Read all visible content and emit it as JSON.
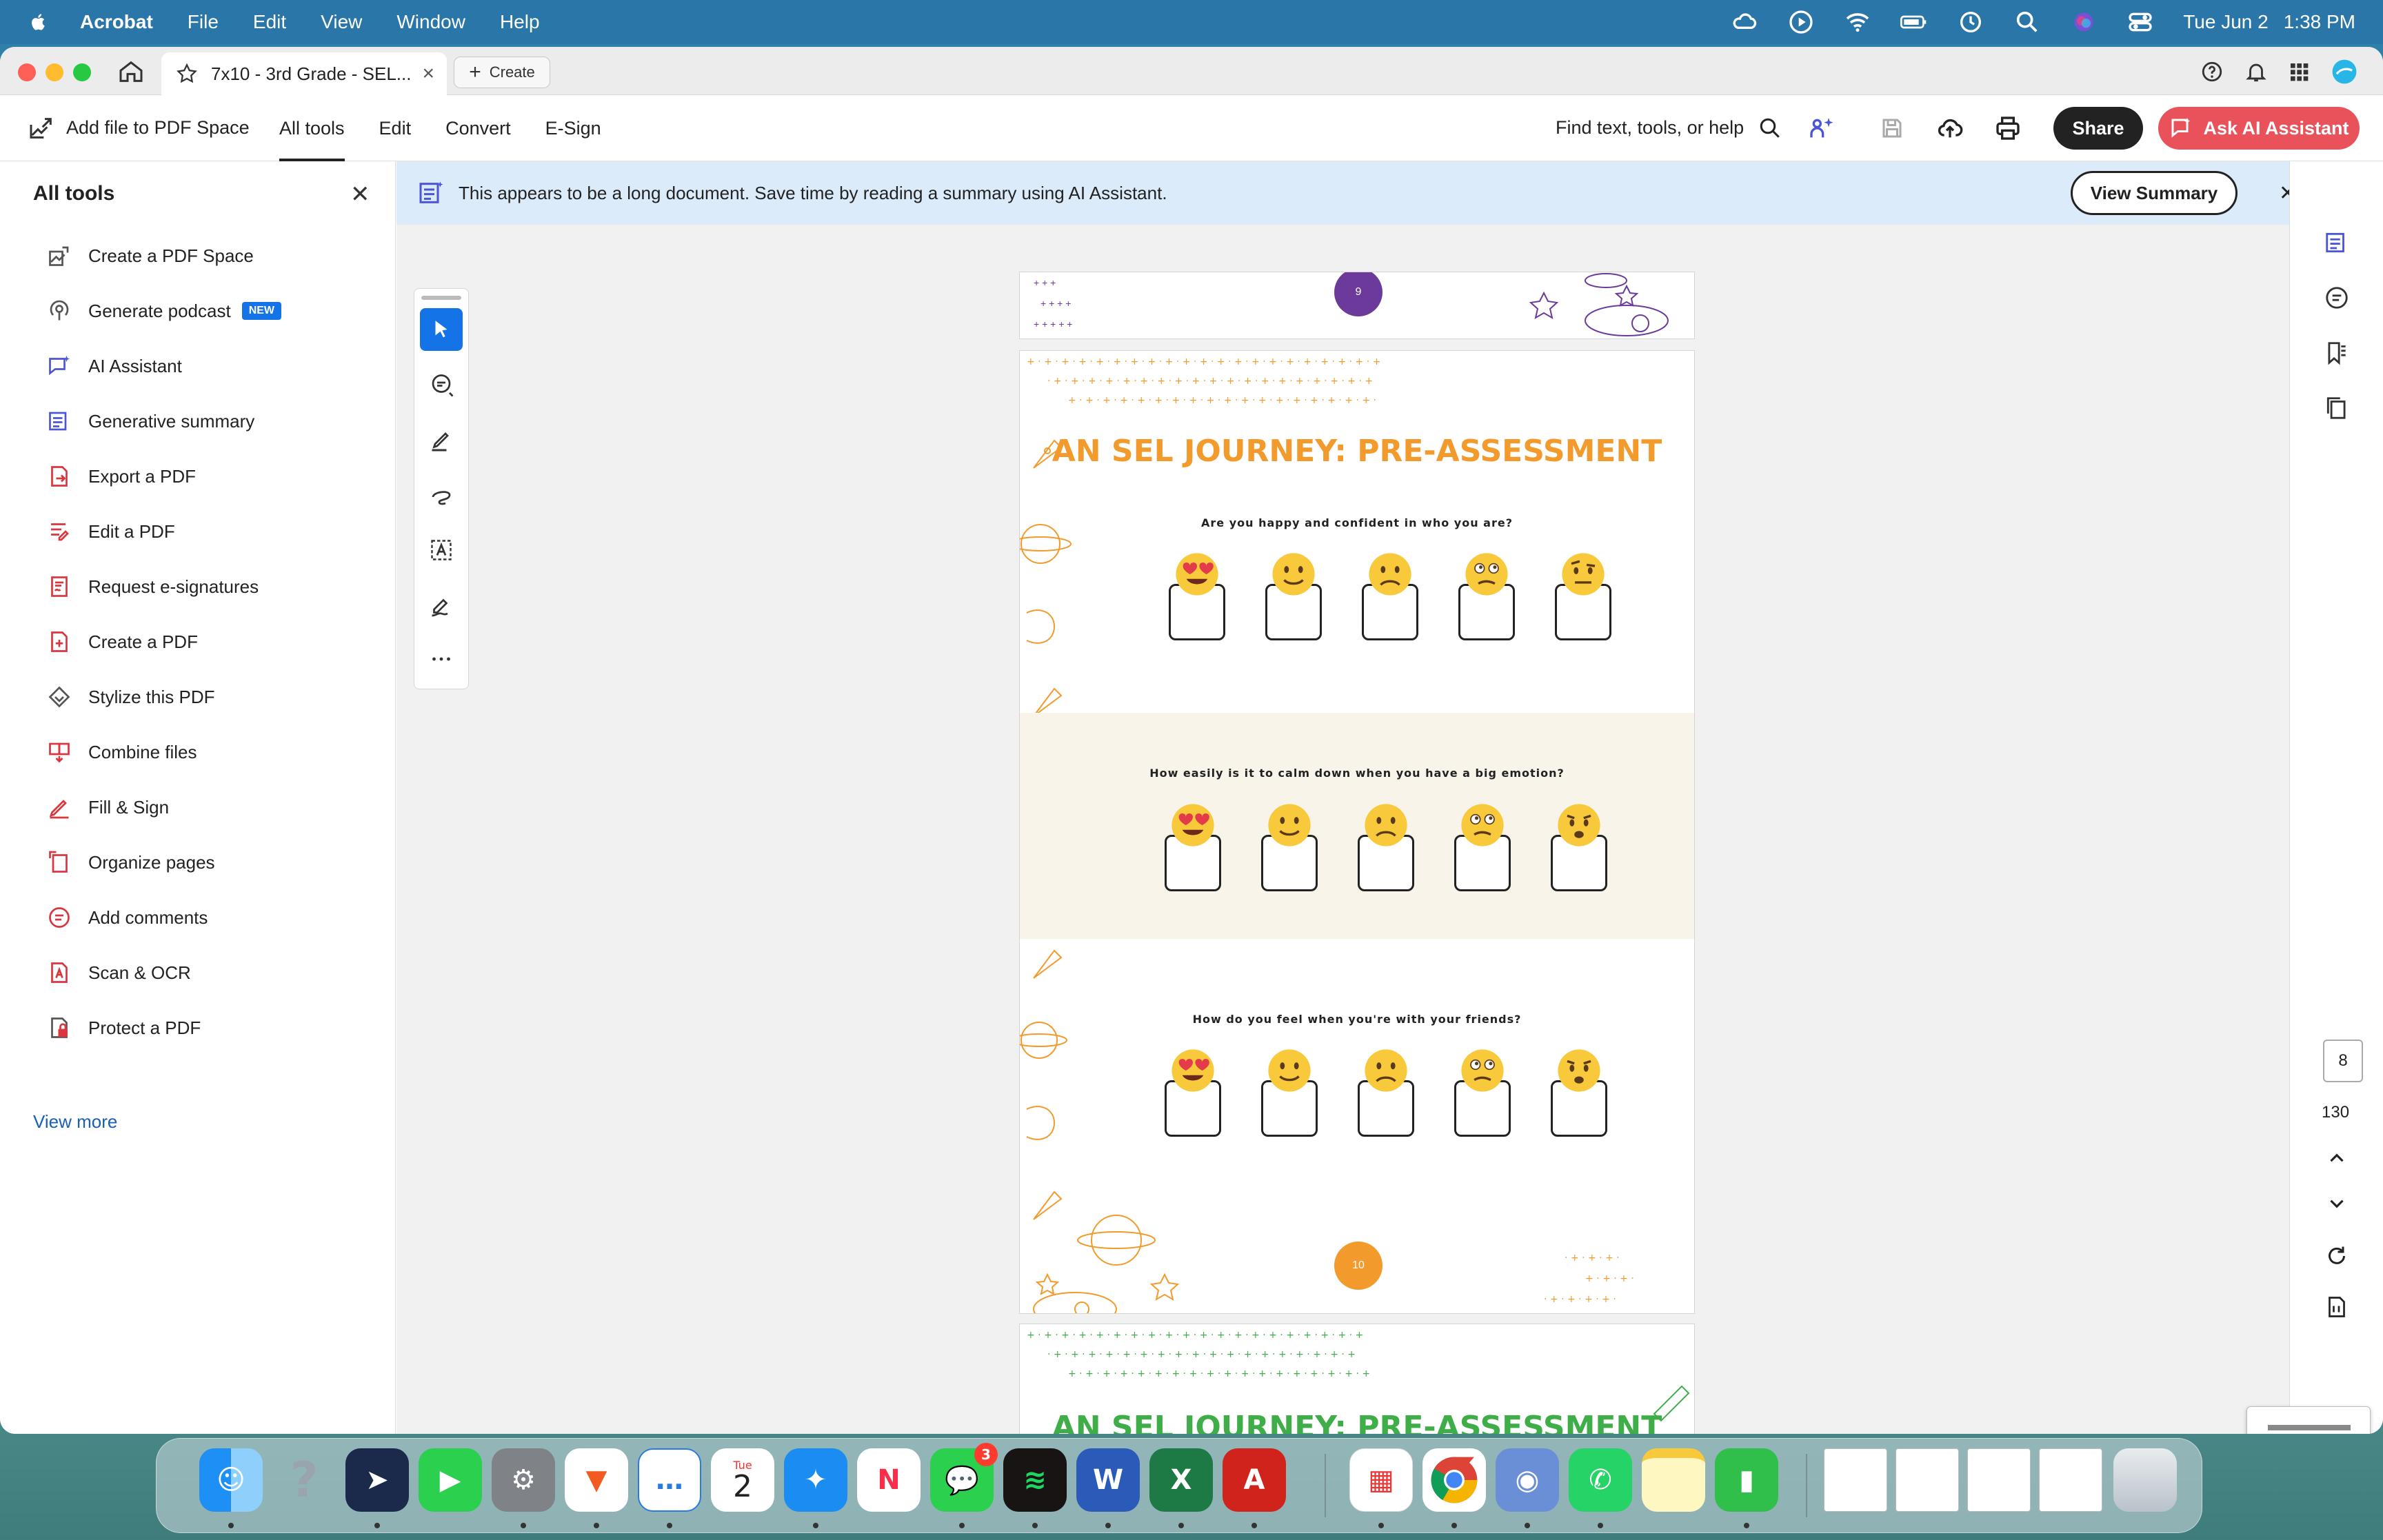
{
  "menubar": {
    "app": "Acrobat",
    "items": [
      "File",
      "Edit",
      "View",
      "Window",
      "Help"
    ],
    "date": "Tue Jun 2",
    "time": "1:38 PM"
  },
  "tabbar": {
    "doc_tab_title": "7x10 - 3rd Grade - SEL...",
    "create_label": "Create"
  },
  "toolbar": {
    "add_file": "Add file to PDF Space",
    "tabs": [
      "All tools",
      "Edit",
      "Convert",
      "E-Sign"
    ],
    "find": "Find text, tools, or help",
    "share": "Share",
    "ask_ai": "Ask AI Assistant"
  },
  "leftpanel": {
    "title": "All tools",
    "items": [
      {
        "label": "Create a PDF Space"
      },
      {
        "label": "Generate podcast",
        "badge": "NEW"
      },
      {
        "label": "AI Assistant"
      },
      {
        "label": "Generative summary"
      },
      {
        "label": "Export a PDF"
      },
      {
        "label": "Edit a PDF"
      },
      {
        "label": "Request e-signatures"
      },
      {
        "label": "Create a PDF"
      },
      {
        "label": "Stylize this PDF"
      },
      {
        "label": "Combine files"
      },
      {
        "label": "Fill & Sign"
      },
      {
        "label": "Organize pages"
      },
      {
        "label": "Add comments"
      },
      {
        "label": "Scan & OCR"
      },
      {
        "label": "Protect a PDF"
      }
    ],
    "view_more": "View more"
  },
  "banner": {
    "text": "This appears to be a long document. Save time by reading a summary using AI Assistant.",
    "button": "View Summary"
  },
  "document": {
    "page9_number": "9",
    "page10": {
      "title": "AN SEL JOURNEY: PRE-ASSESSMENT",
      "questions": [
        "Are you happy and confident in who you are?",
        "How easily is it to calm down when you have a big emotion?",
        "How do you feel when you're with your friends?"
      ],
      "number": "10"
    },
    "page11_title": "AN SEL JOURNEY: PRE-ASSESSMENT"
  },
  "navigation": {
    "current_page": "8",
    "total_pages": "130"
  },
  "dock": {
    "calendar_day": "Tue",
    "calendar_date": "2",
    "messages_badge": "3"
  },
  "colors": {
    "orange": "#f39a2d",
    "green": "#3fae49",
    "purple": "#6b3a9a",
    "accent_blue": "#1473e6",
    "ai_red": "#e9525a"
  }
}
